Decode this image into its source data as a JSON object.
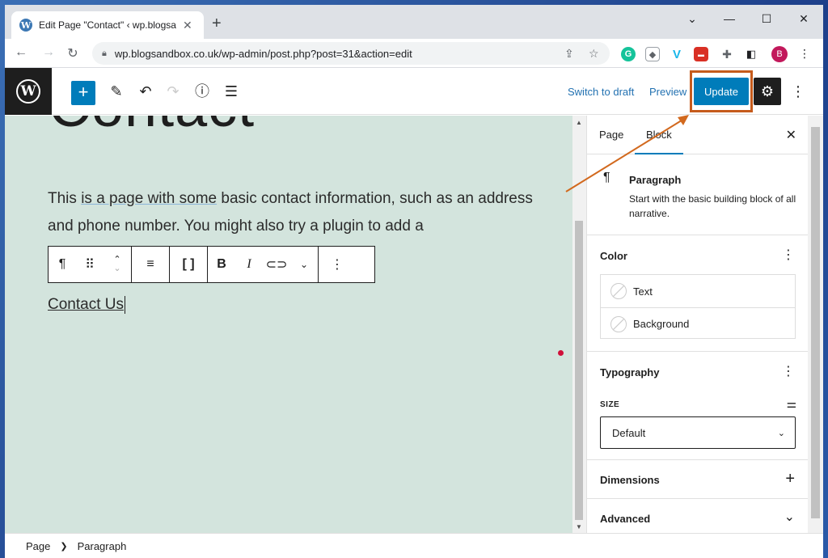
{
  "browser": {
    "tab_title": "Edit Page \"Contact\" ‹ wp.blogsandbox",
    "tab_close": "✕",
    "new_tab": "+",
    "url": "wp.blogsandbox.co.uk/wp-admin/post.php?post=31&action=edit",
    "avatar_letter": "B"
  },
  "editor_header": {
    "add_label": "+",
    "switch_to_draft": "Switch to draft",
    "preview": "Preview",
    "update": "Update"
  },
  "canvas": {
    "title_partial": "Contact",
    "paragraph": {
      "part1": "This ",
      "part2": "is a page with some",
      "part3": " basic contact information, such as an address and phone number. You might also try a plugin to add a"
    },
    "link_text": "Contact Us"
  },
  "sidebar": {
    "tabs": [
      "Page",
      "Block"
    ],
    "active_tab": "Block",
    "block_name": "Paragraph",
    "block_description": "Start with the basic building block of all narrative.",
    "color_panel": {
      "title": "Color",
      "options": [
        "Text",
        "Background"
      ]
    },
    "typography_panel": {
      "title": "Typography",
      "size_label": "SIZE",
      "size_value": "Default"
    },
    "dimensions_panel": {
      "title": "Dimensions"
    },
    "advanced_panel": {
      "title": "Advanced"
    }
  },
  "footer": {
    "breadcrumb": [
      "Page",
      "Paragraph"
    ]
  },
  "colors": {
    "accent": "#007cba",
    "highlight": "#c65b1c",
    "canvas_bg": "#d3e4dd"
  }
}
